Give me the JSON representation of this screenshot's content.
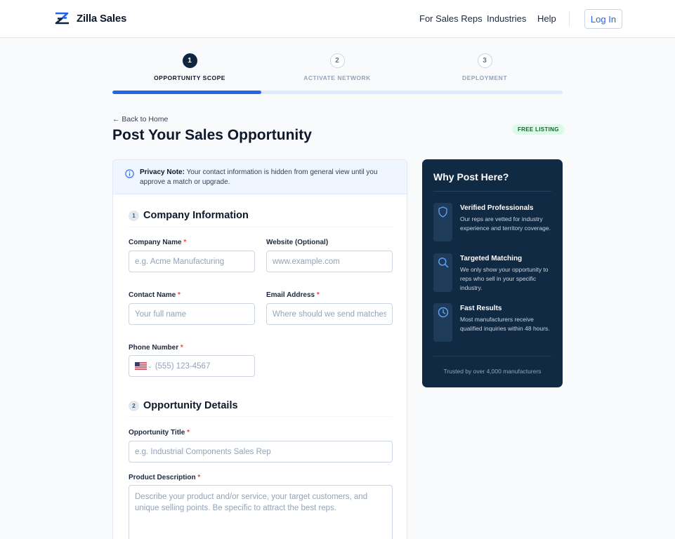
{
  "header": {
    "brand": "Zilla Sales",
    "nav": [
      "For Sales Reps",
      "Industries",
      "Help"
    ],
    "login_label": "Log In"
  },
  "stepper": {
    "steps": [
      {
        "number": "1",
        "label": "OPPORTUNITY SCOPE",
        "active": true
      },
      {
        "number": "2",
        "label": "ACTIVATE NETWORK",
        "active": false
      },
      {
        "number": "3",
        "label": "DEPLOYMENT",
        "active": false
      }
    ],
    "progress_fraction": 0.33
  },
  "page": {
    "back_link": "← Back to Home",
    "title": "Post Your Sales Opportunity",
    "badge": "FREE LISTING"
  },
  "privacy": {
    "label": "Privacy Note:",
    "text": "Your contact information is hidden from general view until you approve a match or upgrade."
  },
  "sections": {
    "company": {
      "number": "1",
      "title": "Company Information"
    },
    "opportunity": {
      "number": "2",
      "title": "Opportunity Details"
    }
  },
  "fields": {
    "company_name": {
      "label": "Company Name",
      "placeholder": "e.g. Acme Manufacturing",
      "required": "*"
    },
    "website": {
      "label": "Website (Optional)",
      "placeholder": "www.example.com"
    },
    "contact_name": {
      "label": "Contact Name",
      "placeholder": "Your full name",
      "required": "*"
    },
    "email": {
      "label": "Email Address",
      "placeholder": "Where should we send matches?",
      "required": "*"
    },
    "phone": {
      "label": "Phone Number",
      "placeholder": "(555) 123-4567",
      "required": "*",
      "country": "US"
    },
    "opportunity_title": {
      "label": "Opportunity Title",
      "placeholder": "e.g. Industrial Components Sales Rep",
      "required": "*"
    },
    "product_description": {
      "label": "Product Description",
      "placeholder": "Describe your product and/or service, your target customers, and unique selling points. Be specific to attract the best reps.",
      "required": "*"
    }
  },
  "sidebar": {
    "title": "Why Post Here?",
    "benefits": [
      {
        "icon": "shield-icon",
        "title": "Verified Professionals",
        "desc": "Our reps are vetted for industry experience and territory coverage."
      },
      {
        "icon": "search-icon",
        "title": "Targeted Matching",
        "desc": "We only show your opportunity to reps who sell in your specific industry."
      },
      {
        "icon": "clock-icon",
        "title": "Fast Results",
        "desc": "Most manufacturers receive qualified inquiries within 48 hours."
      }
    ],
    "footer": "Trusted by over 4,000 manufacturers"
  },
  "colors": {
    "accent": "#2563eb",
    "navy": "#102a43",
    "required": "#ef4444",
    "badge_bg": "#dcfce7",
    "badge_text": "#166534"
  }
}
